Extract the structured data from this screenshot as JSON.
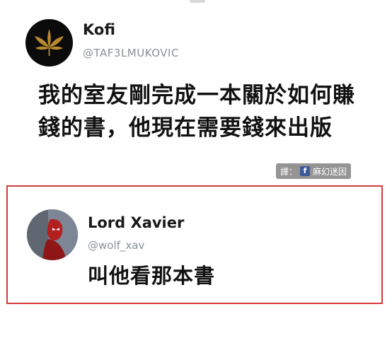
{
  "tweet": {
    "author_name": "Kofi",
    "author_handle": "@TAF3LMUKOVIC",
    "text": "我的室友剛完成一本關於如何賺錢的書，他現在需要錢來出版"
  },
  "watermark": {
    "prefix": "譯：",
    "icon": "facebook-icon",
    "icon_glyph": "f",
    "page_name": "麻幻迷因"
  },
  "reply": {
    "author_name": "Lord Xavier",
    "author_handle": "@wolf_xav",
    "text": "叫他看那本書",
    "highlight_color": "#d63a3a"
  }
}
